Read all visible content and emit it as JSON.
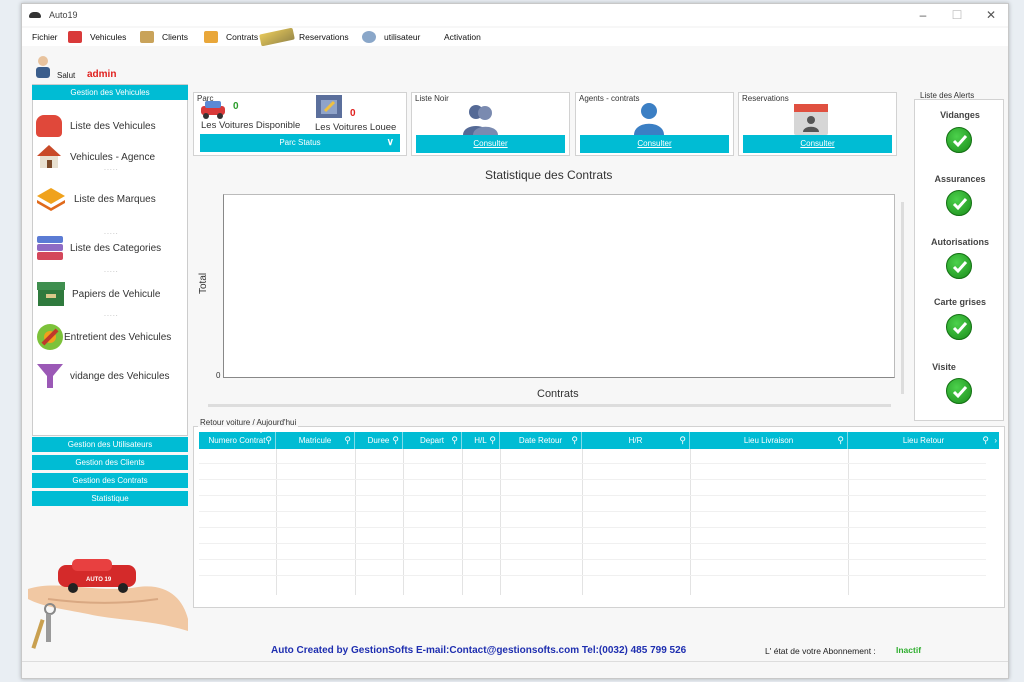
{
  "window": {
    "title": "Auto19"
  },
  "menu": {
    "items": [
      {
        "label": "Fichier",
        "icon": "none"
      },
      {
        "label": "Vehicules",
        "icon": "car-icon"
      },
      {
        "label": "Clients",
        "icon": "clients-icon"
      },
      {
        "label": "Contrats",
        "icon": "contract-icon"
      },
      {
        "label": "Reservations",
        "icon": "reservation-icon"
      },
      {
        "label": "utilisateur",
        "icon": "user-icon"
      },
      {
        "label": "Activation",
        "icon": "none"
      }
    ]
  },
  "user": {
    "greeting": "Salut",
    "name": "admin",
    "name_color": "#e0201e"
  },
  "sidebar": {
    "header": "Gestion des Vehicules",
    "items": [
      {
        "label": "Liste des Vehicules",
        "icon": "car-icon",
        "color": "#e0483a"
      },
      {
        "label": "Vehicules - Agence",
        "icon": "house-icon",
        "color": "#c94a28"
      },
      {
        "label": "Liste des Marques",
        "icon": "layers-icon",
        "color": "#f0a21c"
      },
      {
        "label": "Liste des Categories",
        "icon": "stack-icon",
        "color": "#5b7bd4"
      },
      {
        "label": "Papiers de Vehicule",
        "icon": "box-icon",
        "color": "#2f7a3d"
      },
      {
        "label": "Entretient des Vehicules",
        "icon": "wrench-icon",
        "color": "#7cc23a"
      },
      {
        "label": "vidange des Vehicules",
        "icon": "funnel-icon",
        "color": "#9b59b6"
      }
    ],
    "dots": ".....",
    "buttons": [
      "Gestion des Utilisateurs",
      "Gestion des Clients",
      "Gestion des Contrats",
      "Statistique"
    ]
  },
  "parc": {
    "title": "Parc",
    "available_count": "0",
    "available_label": "Les Voitures Disponible",
    "rented_count": "0",
    "rented_label": "Les Voitures Louee",
    "status_button": "Parc Status"
  },
  "cards": [
    {
      "title": "Liste Noir",
      "button": "Consulter"
    },
    {
      "title": "Agents - contrats",
      "button": "Consulter"
    },
    {
      "title": "Reservations",
      "button": "Consulter"
    }
  ],
  "chart": {
    "title": "Statistique des Contrats",
    "ylabel": "Total",
    "xlabel": "Contrats",
    "y_tick": "0"
  },
  "chart_data": {
    "type": "bar",
    "title": "Statistique des Contrats",
    "xlabel": "Contrats",
    "ylabel": "Total",
    "categories": [],
    "values": [],
    "grid": false
  },
  "returns": {
    "title": "Retour voiture / Aujourd'hui",
    "columns": [
      "Numero Contrat",
      "Matricule",
      "Duree",
      "Depart",
      "H/L",
      "Date Retour",
      "H/R",
      "Lieu Livraison",
      "Lieu Retour"
    ],
    "rows": []
  },
  "alerts": {
    "title": "Liste des Alerts",
    "items": [
      "Vidanges",
      "Assurances",
      "Autorisations",
      "Carte grises",
      "Visite"
    ],
    "ok_color": "#2fae2f"
  },
  "footer": {
    "credit": "Auto Created by GestionSofts  E-mail:Contact@gestionsofts.com  Tel:(0032) 485 799 526",
    "subscription_label": "L' état de votre  Abonnement :",
    "subscription_value": "Inactif",
    "subscription_color": "#2fae2f"
  },
  "colors": {
    "accent": "#00bcd4",
    "link_blue": "#1f2fb0"
  }
}
